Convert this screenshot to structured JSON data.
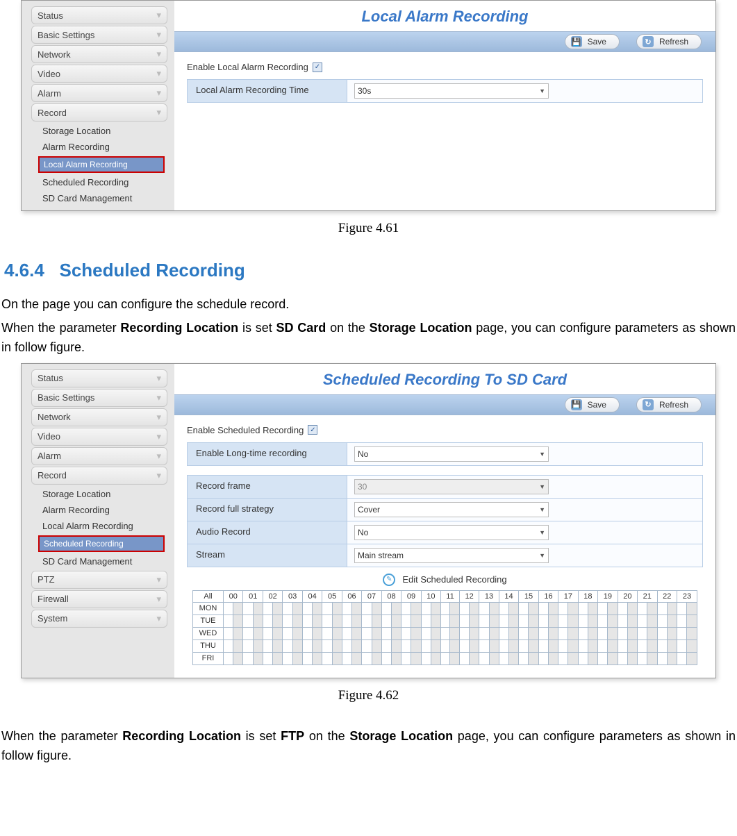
{
  "fig1": {
    "title": "Local Alarm Recording",
    "save": "Save",
    "refresh": "Refresh",
    "enable_label": "Enable Local Alarm Recording",
    "row_label": "Local Alarm Recording Time",
    "row_value": "30s",
    "caption": "Figure 4.61",
    "sidebar": {
      "items": [
        "Status",
        "Basic Settings",
        "Network",
        "Video",
        "Alarm",
        "Record"
      ],
      "subs": [
        "Storage Location",
        "Alarm Recording",
        "Local Alarm Recording",
        "Scheduled Recording",
        "SD Card Management"
      ],
      "active": "Local Alarm Recording"
    }
  },
  "section": {
    "heading_num": "4.6.4",
    "heading_txt": "Scheduled Recording",
    "p1": "On the page you can configure the schedule record.",
    "p2a": "When the parameter ",
    "p2b": "Recording Location",
    "p2c": " is set ",
    "p2d": "SD Card",
    "p2e": " on the ",
    "p2f": "Storage Location",
    "p2g": " page, you can configure parameters as shown in follow figure."
  },
  "fig2": {
    "title": "Scheduled Recording To SD Card",
    "save": "Save",
    "refresh": "Refresh",
    "enable_label": "Enable Scheduled Recording",
    "rows": [
      {
        "label": "Enable Long-time recording",
        "value": "No",
        "disabled": false
      }
    ],
    "rows2": [
      {
        "label": "Record frame",
        "value": "30",
        "disabled": true
      },
      {
        "label": "Record full strategy",
        "value": "Cover",
        "disabled": false
      },
      {
        "label": "Audio Record",
        "value": "No",
        "disabled": false
      },
      {
        "label": "Stream",
        "value": "Main stream",
        "disabled": false
      }
    ],
    "edit_label": "Edit Scheduled Recording",
    "caption": "Figure 4.62",
    "sidebar": {
      "items": [
        "Status",
        "Basic Settings",
        "Network",
        "Video",
        "Alarm",
        "Record"
      ],
      "subs": [
        "Storage Location",
        "Alarm Recording",
        "Local Alarm Recording",
        "Scheduled Recording",
        "SD Card Management"
      ],
      "tail": [
        "PTZ",
        "Firewall",
        "System"
      ],
      "active": "Scheduled Recording"
    },
    "sched": {
      "corner": "All",
      "hours": [
        "00",
        "01",
        "02",
        "03",
        "04",
        "05",
        "06",
        "07",
        "08",
        "09",
        "10",
        "11",
        "12",
        "13",
        "14",
        "15",
        "16",
        "17",
        "18",
        "19",
        "20",
        "21",
        "22",
        "23"
      ],
      "days": [
        "MON",
        "TUE",
        "WED",
        "THU",
        "FRI"
      ]
    }
  },
  "closer": {
    "a": "When the parameter ",
    "b": "Recording Location",
    "c": " is set ",
    "d": "FTP",
    "e": " on the ",
    "f": "Storage Location",
    "g": " page, you can configure parameters as shown in follow figure."
  }
}
